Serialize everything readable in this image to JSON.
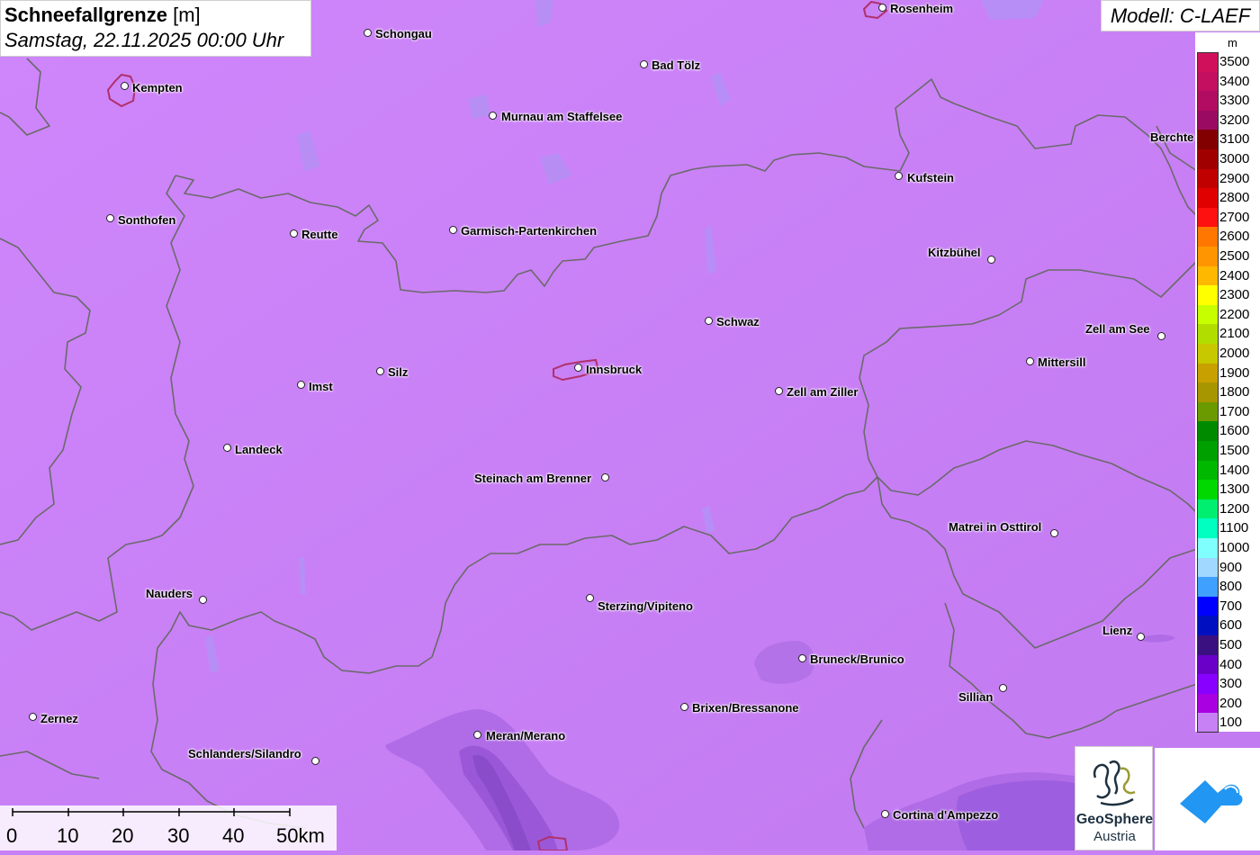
{
  "title": {
    "main": "Schneefallgrenze",
    "unit": "[m]",
    "datetime": "Samstag, 22.11.2025 00:00 Uhr"
  },
  "model": "Modell: C-LAEF",
  "legend": {
    "unit": "m",
    "items": [
      {
        "label": "3500",
        "color": "#d1105c"
      },
      {
        "label": "3400",
        "color": "#c40e60"
      },
      {
        "label": "3300",
        "color": "#b20c62"
      },
      {
        "label": "3200",
        "color": "#9a0a63"
      },
      {
        "label": "3100",
        "color": "#820000"
      },
      {
        "label": "3000",
        "color": "#a10000"
      },
      {
        "label": "2900",
        "color": "#c00000"
      },
      {
        "label": "2800",
        "color": "#e00000"
      },
      {
        "label": "2700",
        "color": "#ff1010"
      },
      {
        "label": "2600",
        "color": "#ff7700"
      },
      {
        "label": "2500",
        "color": "#ff9500"
      },
      {
        "label": "2400",
        "color": "#ffb800"
      },
      {
        "label": "2300",
        "color": "#ffff00"
      },
      {
        "label": "2200",
        "color": "#c8ff00"
      },
      {
        "label": "2100",
        "color": "#b2dd00"
      },
      {
        "label": "2000",
        "color": "#c8c800"
      },
      {
        "label": "1900",
        "color": "#c8a000"
      },
      {
        "label": "1800",
        "color": "#a89600"
      },
      {
        "label": "1700",
        "color": "#6a9a00"
      },
      {
        "label": "1600",
        "color": "#008a00"
      },
      {
        "label": "1500",
        "color": "#00a000"
      },
      {
        "label": "1400",
        "color": "#00b800"
      },
      {
        "label": "1300",
        "color": "#00d800"
      },
      {
        "label": "1200",
        "color": "#00ef70"
      },
      {
        "label": "1100",
        "color": "#00ffc0"
      },
      {
        "label": "1000",
        "color": "#80ffff"
      },
      {
        "label": "900",
        "color": "#a0d8ff"
      },
      {
        "label": "800",
        "color": "#40a0ff"
      },
      {
        "label": "700",
        "color": "#0000ff"
      },
      {
        "label": "600",
        "color": "#0010c0"
      },
      {
        "label": "500",
        "color": "#3a1080"
      },
      {
        "label": "400",
        "color": "#6a00c8"
      },
      {
        "label": "300",
        "color": "#8800ff"
      },
      {
        "label": "200",
        "color": "#a800e0"
      },
      {
        "label": "100",
        "color": "#c880f5"
      }
    ]
  },
  "cities": [
    {
      "name": "Rosenheim"
    },
    {
      "name": "Schongau"
    },
    {
      "name": "Kempten"
    },
    {
      "name": "Bad Tölz"
    },
    {
      "name": "Murnau am Staffelsee"
    },
    {
      "name": "Berchte"
    },
    {
      "name": "Kufstein"
    },
    {
      "name": "Sonthofen"
    },
    {
      "name": "Reutte"
    },
    {
      "name": "Garmisch-Partenkirchen"
    },
    {
      "name": "Kitzbühel"
    },
    {
      "name": "Schwaz"
    },
    {
      "name": "Zell am See"
    },
    {
      "name": "Mittersill"
    },
    {
      "name": "Silz"
    },
    {
      "name": "Innsbruck"
    },
    {
      "name": "Imst"
    },
    {
      "name": "Zell am Ziller"
    },
    {
      "name": "Landeck"
    },
    {
      "name": "Steinach am Brenner"
    },
    {
      "name": "Matrei in Osttirol"
    },
    {
      "name": "Nauders"
    },
    {
      "name": "Sterzing/Vipiteno"
    },
    {
      "name": "Lienz"
    },
    {
      "name": "Bruneck/Brunico"
    },
    {
      "name": "Sillian"
    },
    {
      "name": "Brixen/Bressanone"
    },
    {
      "name": "Zernez"
    },
    {
      "name": "Meran/Merano"
    },
    {
      "name": "Schlanders/Silandro"
    },
    {
      "name": "Cortina d'Ampezzo"
    }
  ],
  "scale": {
    "labels": [
      "0",
      "10",
      "20",
      "30",
      "40",
      "50km"
    ]
  },
  "logos": {
    "geosphere_name": "GeoSphere",
    "geosphere_sub": "Austria",
    "app_icon": "cloud-arrow-icon"
  }
}
